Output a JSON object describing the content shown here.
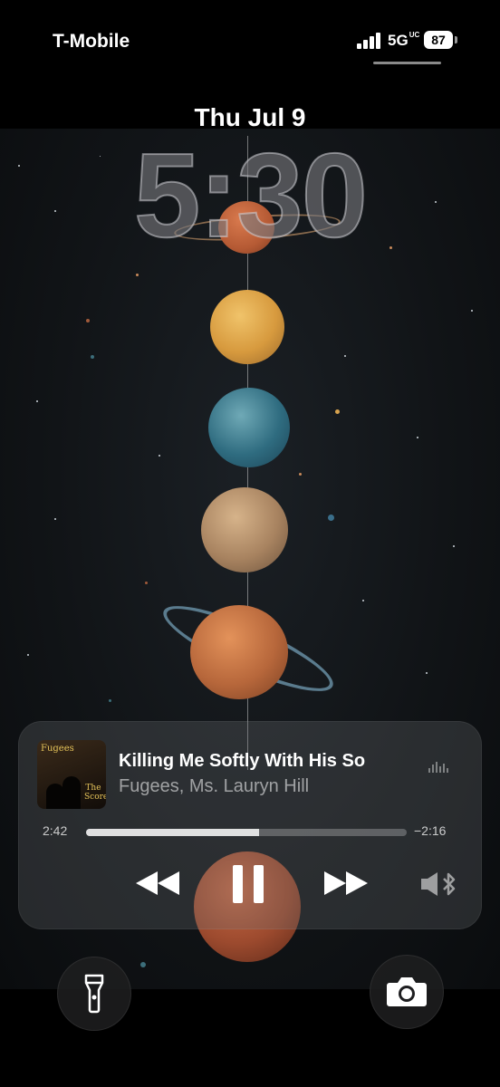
{
  "status_bar": {
    "carrier": "T-Mobile",
    "network": "5G",
    "network_suffix": "UC",
    "battery": "87"
  },
  "lock_screen": {
    "date": "Thu Jul 9",
    "time": "5:30"
  },
  "now_playing": {
    "album_art_title": "Fugees",
    "album_art_subtitle": "The Score",
    "song_title": "Killing Me Softly With His So",
    "artist": "Fugees, Ms. Lauryn Hill",
    "elapsed": "2:42",
    "remaining": "−2:16",
    "progress": 0.54
  },
  "colors": {
    "accent": "#ffffff",
    "player_bg": "#6e7378"
  },
  "icons": {
    "rewind": "rewind-icon",
    "pause": "pause-icon",
    "forward": "fast-forward-icon",
    "speaker": "speaker-bluetooth-icon",
    "flashlight": "flashlight-icon",
    "camera": "camera-icon"
  }
}
